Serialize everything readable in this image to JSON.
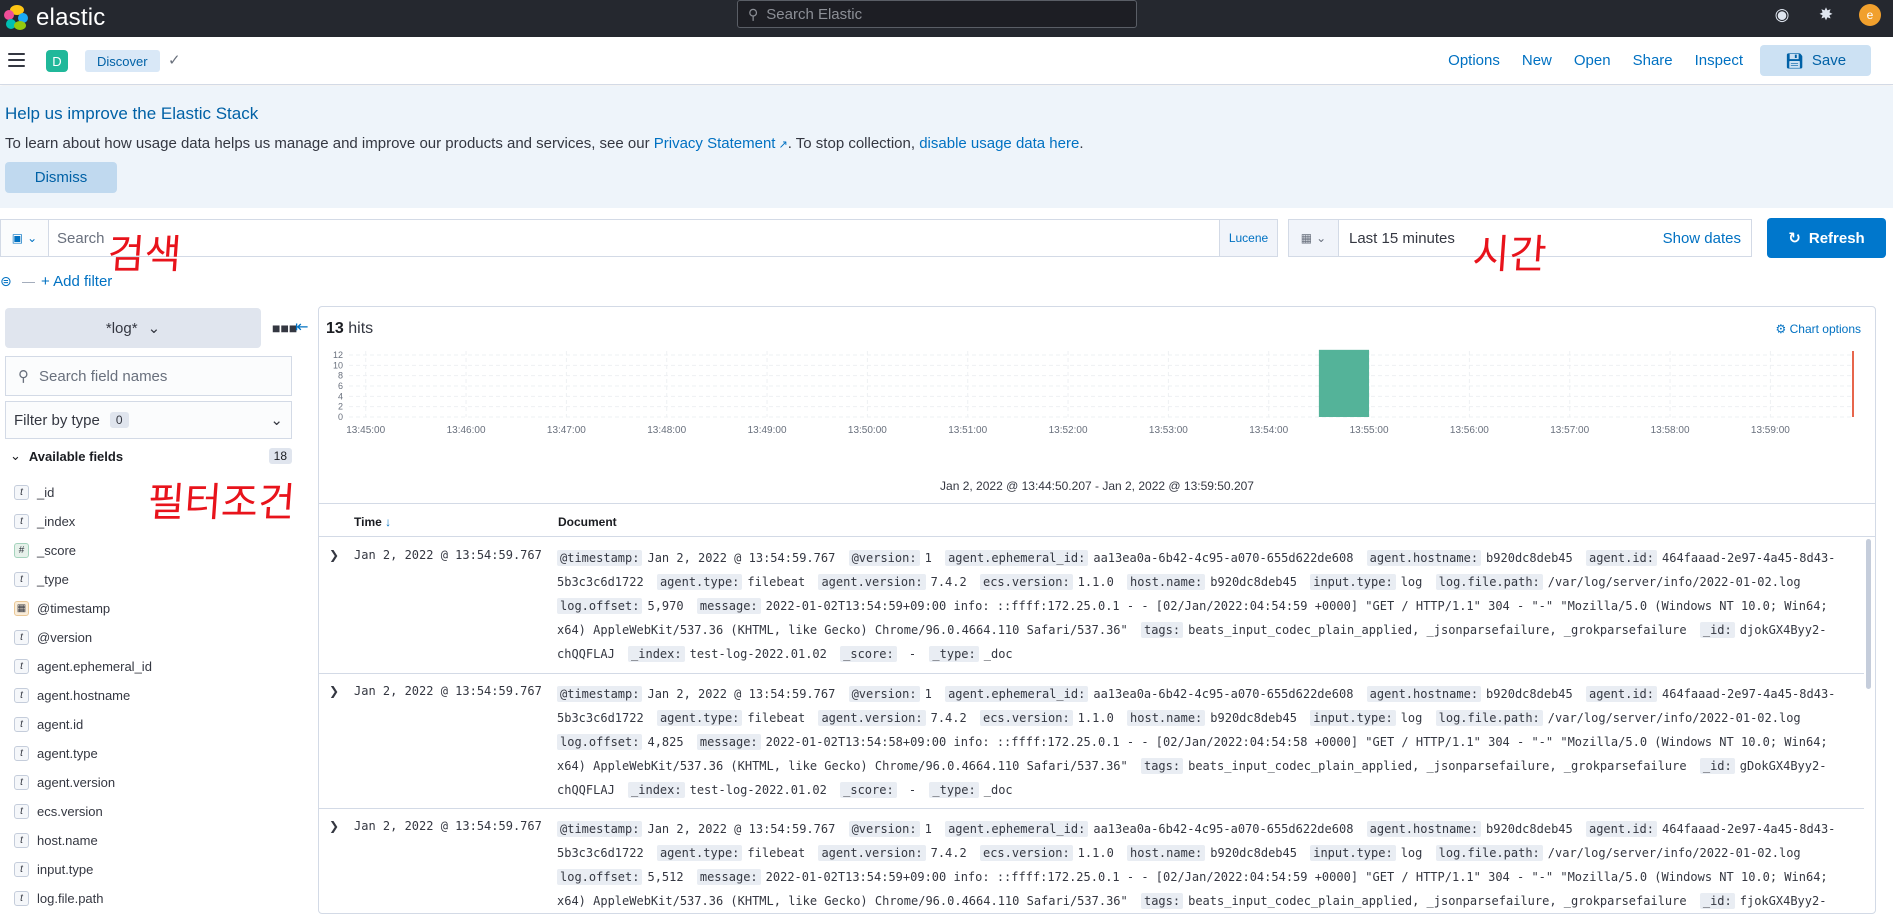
{
  "header": {
    "brand": "elastic",
    "search_placeholder": "Search Elastic",
    "avatar_initial": "e"
  },
  "appbar": {
    "space_initial": "D",
    "breadcrumb": "Discover",
    "nav": [
      "Options",
      "New",
      "Open",
      "Share",
      "Inspect"
    ],
    "save_label": "Save"
  },
  "callout": {
    "title": "Help us improve the Elastic Stack",
    "text_before": "To learn about how usage data helps us manage and improve our products and services, see our ",
    "privacy_link": "Privacy Statement",
    "text_middle": ". To stop collection, ",
    "disable_link": "disable usage data here",
    "text_after": ".",
    "dismiss_label": "Dismiss"
  },
  "query": {
    "placeholder": "Search",
    "language": "Lucene",
    "time_label": "Last 15 minutes",
    "show_dates": "Show dates",
    "refresh_label": "Refresh",
    "add_filter": "+ Add filter"
  },
  "sidebar": {
    "index_pattern": "*log*",
    "field_search_placeholder": "Search field names",
    "filter_by_type": "Filter by type",
    "filter_count": "0",
    "available_label": "Available fields",
    "available_count": "18",
    "fields": [
      {
        "type": "t",
        "name": "_id"
      },
      {
        "type": "t",
        "name": "_index"
      },
      {
        "type": "#",
        "name": "_score"
      },
      {
        "type": "t",
        "name": "_type"
      },
      {
        "type": "date",
        "name": "@timestamp"
      },
      {
        "type": "t",
        "name": "@version"
      },
      {
        "type": "t",
        "name": "agent.ephemeral_id"
      },
      {
        "type": "t",
        "name": "agent.hostname"
      },
      {
        "type": "t",
        "name": "agent.id"
      },
      {
        "type": "t",
        "name": "agent.type"
      },
      {
        "type": "t",
        "name": "agent.version"
      },
      {
        "type": "t",
        "name": "ecs.version"
      },
      {
        "type": "t",
        "name": "host.name"
      },
      {
        "type": "t",
        "name": "input.type"
      },
      {
        "type": "t",
        "name": "log.file.path"
      }
    ]
  },
  "results": {
    "hits_count": "13",
    "hits_label": "hits",
    "chart_options": "Chart options",
    "date_range": "Jan 2, 2022 @ 13:44:50.207 - Jan 2, 2022 @ 13:59:50.207",
    "col_time": "Time",
    "col_document": "Document"
  },
  "chart_data": {
    "type": "bar",
    "x_ticks": [
      "13:45:00",
      "13:46:00",
      "13:47:00",
      "13:48:00",
      "13:49:00",
      "13:50:00",
      "13:51:00",
      "13:52:00",
      "13:53:00",
      "13:54:00",
      "13:55:00",
      "13:56:00",
      "13:57:00",
      "13:58:00",
      "13:59:00"
    ],
    "y_ticks": [
      0,
      2,
      4,
      6,
      8,
      10,
      12
    ],
    "ylim": [
      0,
      12
    ],
    "bars": [
      {
        "start": "13:54:30",
        "end": "13:55:00",
        "value": 13
      }
    ],
    "bar_color": "#54b399",
    "now_marker_color": "#e7664c"
  },
  "rows": [
    {
      "time": "Jan 2, 2022 @ 13:54:59.767",
      "fields": [
        {
          "k": "@timestamp:",
          "v": "Jan 2, 2022 @ 13:54:59.767"
        },
        {
          "k": "@version:",
          "v": "1"
        },
        {
          "k": "agent.ephemeral_id:",
          "v": "aa13ea0a-6b42-4c95-a070-655d622de608"
        },
        {
          "k": "agent.hostname:",
          "v": "b920dc8deb45"
        },
        {
          "k": "agent.id:",
          "v": "464faaad-2e97-4a45-8d43-5b3c3c6d1722"
        },
        {
          "k": "agent.type:",
          "v": "filebeat"
        },
        {
          "k": "agent.version:",
          "v": "7.4.2"
        },
        {
          "k": "ecs.version:",
          "v": "1.1.0"
        },
        {
          "k": "host.name:",
          "v": "b920dc8deb45"
        },
        {
          "k": "input.type:",
          "v": "log"
        },
        {
          "k": "log.file.path:",
          "v": "/var/log/server/info/2022-01-02.log"
        },
        {
          "k": "log.offset:",
          "v": "5,970"
        },
        {
          "k": "message:",
          "v": "2022-01-02T13:54:59+09:00 info: ::ffff:172.25.0.1 - - [02/Jan/2022:04:54:59 +0000] \"GET / HTTP/1.1\" 304 - \"-\" \"Mozilla/5.0 (Windows NT 10.0; Win64; x64) AppleWebKit/537.36 (KHTML, like Gecko) Chrome/96.0.4664.110 Safari/537.36\""
        },
        {
          "k": "tags:",
          "v": "beats_input_codec_plain_applied, _jsonparsefailure, _grokparsefailure"
        },
        {
          "k": "_id:",
          "v": "djokGX4Byy2-chQQFLAJ"
        },
        {
          "k": "_index:",
          "v": "test-log-2022.01.02"
        },
        {
          "k": "_score:",
          "v": " -"
        },
        {
          "k": "_type:",
          "v": "_doc"
        }
      ]
    },
    {
      "time": "Jan 2, 2022 @ 13:54:59.767",
      "fields": [
        {
          "k": "@timestamp:",
          "v": "Jan 2, 2022 @ 13:54:59.767"
        },
        {
          "k": "@version:",
          "v": "1"
        },
        {
          "k": "agent.ephemeral_id:",
          "v": "aa13ea0a-6b42-4c95-a070-655d622de608"
        },
        {
          "k": "agent.hostname:",
          "v": "b920dc8deb45"
        },
        {
          "k": "agent.id:",
          "v": "464faaad-2e97-4a45-8d43-5b3c3c6d1722"
        },
        {
          "k": "agent.type:",
          "v": "filebeat"
        },
        {
          "k": "agent.version:",
          "v": "7.4.2"
        },
        {
          "k": "ecs.version:",
          "v": "1.1.0"
        },
        {
          "k": "host.name:",
          "v": "b920dc8deb45"
        },
        {
          "k": "input.type:",
          "v": "log"
        },
        {
          "k": "log.file.path:",
          "v": "/var/log/server/info/2022-01-02.log"
        },
        {
          "k": "log.offset:",
          "v": "4,825"
        },
        {
          "k": "message:",
          "v": "2022-01-02T13:54:58+09:00 info: ::ffff:172.25.0.1 - - [02/Jan/2022:04:54:58 +0000] \"GET / HTTP/1.1\" 304 - \"-\" \"Mozilla/5.0 (Windows NT 10.0; Win64; x64) AppleWebKit/537.36 (KHTML, like Gecko) Chrome/96.0.4664.110 Safari/537.36\""
        },
        {
          "k": "tags:",
          "v": "beats_input_codec_plain_applied, _jsonparsefailure, _grokparsefailure"
        },
        {
          "k": "_id:",
          "v": "gDokGX4Byy2-chQQFLAJ"
        },
        {
          "k": "_index:",
          "v": "test-log-2022.01.02"
        },
        {
          "k": "_score:",
          "v": " -"
        },
        {
          "k": "_type:",
          "v": "_doc"
        }
      ]
    },
    {
      "time": "Jan 2, 2022 @ 13:54:59.767",
      "fields": [
        {
          "k": "@timestamp:",
          "v": "Jan 2, 2022 @ 13:54:59.767"
        },
        {
          "k": "@version:",
          "v": "1"
        },
        {
          "k": "agent.ephemeral_id:",
          "v": "aa13ea0a-6b42-4c95-a070-655d622de608"
        },
        {
          "k": "agent.hostname:",
          "v": "b920dc8deb45"
        },
        {
          "k": "agent.id:",
          "v": "464faaad-2e97-4a45-8d43-5b3c3c6d1722"
        },
        {
          "k": "agent.type:",
          "v": "filebeat"
        },
        {
          "k": "agent.version:",
          "v": "7.4.2"
        },
        {
          "k": "ecs.version:",
          "v": "1.1.0"
        },
        {
          "k": "host.name:",
          "v": "b920dc8deb45"
        },
        {
          "k": "input.type:",
          "v": "log"
        },
        {
          "k": "log.file.path:",
          "v": "/var/log/server/info/2022-01-02.log"
        },
        {
          "k": "log.offset:",
          "v": "5,512"
        },
        {
          "k": "message:",
          "v": "2022-01-02T13:54:59+09:00 info: ::ffff:172.25.0.1 - - [02/Jan/2022:04:54:59 +0000] \"GET / HTTP/1.1\" 304 - \"-\" \"Mozilla/5.0 (Windows NT 10.0; Win64; x64) AppleWebKit/537.36 (KHTML, like Gecko) Chrome/96.0.4664.110 Safari/537.36\""
        },
        {
          "k": "tags:",
          "v": "beats_input_codec_plain_applied, _jsonparsefailure, _grokparsefailure"
        },
        {
          "k": "_id:",
          "v": "fjokGX4Byy2-"
        }
      ]
    }
  ],
  "annotations": {
    "search": "검색",
    "time": "시간",
    "filter": "필터조건",
    "color": "#e8131b"
  }
}
